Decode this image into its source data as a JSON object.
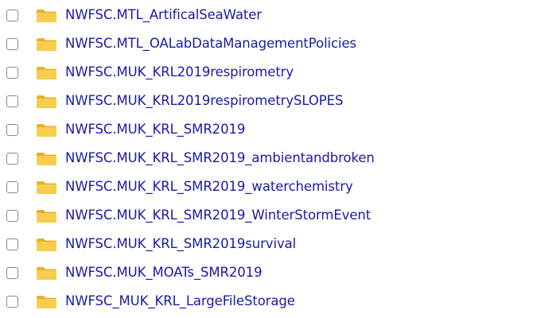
{
  "folders": [
    {
      "name": "NWFSC.MTL_ArtificalSeaWater"
    },
    {
      "name": "NWFSC.MTL_OALabDataManagementPolicies"
    },
    {
      "name": "NWFSC.MUK_KRL2019respirometry"
    },
    {
      "name": "NWFSC.MUK_KRL2019respirometrySLOPES"
    },
    {
      "name": "NWFSC.MUK_KRL_SMR2019"
    },
    {
      "name": "NWFSC.MUK_KRL_SMR2019_ambientandbroken"
    },
    {
      "name": "NWFSC.MUK_KRL_SMR2019_waterchemistry"
    },
    {
      "name": "NWFSC.MUK_KRL_SMR2019_WinterStormEvent"
    },
    {
      "name": "NWFSC.MUK_KRL_SMR2019survival"
    },
    {
      "name": "NWFSC.MUK_MOATs_SMR2019"
    },
    {
      "name": "NWFSC_MUK_KRL_LargeFileStorage"
    }
  ],
  "colors": {
    "link": "#1a1aa6",
    "folder_body": "#f5c842",
    "folder_tab": "#e6b02e",
    "checkbox_border": "#8a8a8a"
  },
  "icons": {
    "row_icon": "folder-icon",
    "row_select": "checkbox"
  }
}
